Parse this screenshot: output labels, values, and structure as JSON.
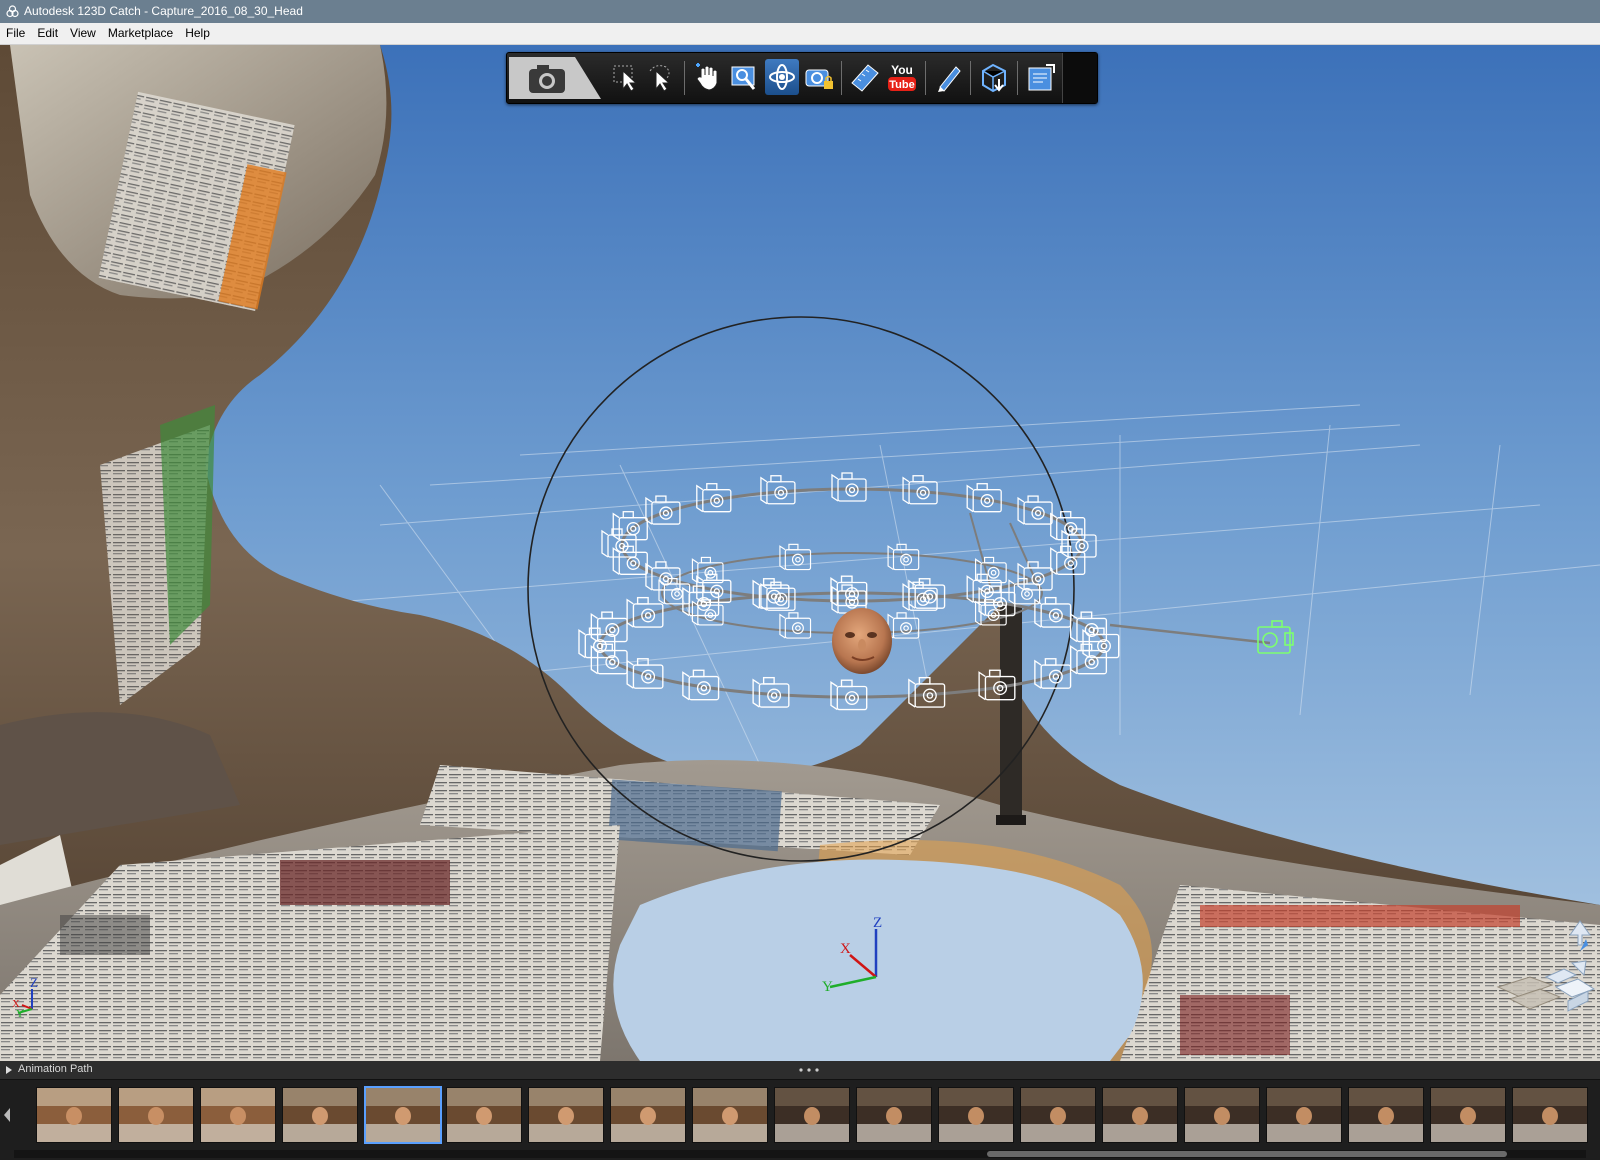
{
  "window": {
    "title": "Autodesk 123D Catch - Capture_2016_08_30_Head",
    "app_icon": "autodesk-trefoil-icon"
  },
  "menubar": {
    "items": [
      {
        "label": "File",
        "name": "menu-file"
      },
      {
        "label": "Edit",
        "name": "menu-edit"
      },
      {
        "label": "View",
        "name": "menu-view"
      },
      {
        "label": "Marketplace",
        "name": "menu-marketplace"
      },
      {
        "label": "Help",
        "name": "menu-help"
      }
    ]
  },
  "toolbar": {
    "buttons": [
      {
        "icon": "camera-tab-icon"
      },
      {
        "icon": "select-arrow-icon"
      },
      {
        "icon": "lasso-select-icon"
      },
      {
        "icon": "pan-hand-icon"
      },
      {
        "icon": "zoom-icon"
      },
      {
        "icon": "orbit-icon",
        "active": true
      },
      {
        "icon": "camera-lock-icon"
      },
      {
        "icon": "ruler-icon"
      },
      {
        "icon": "youtube-icon",
        "text_top": "You",
        "text_bottom": "Tube"
      },
      {
        "icon": "pen-icon"
      },
      {
        "icon": "mesh-download-icon"
      },
      {
        "icon": "export-icon"
      }
    ]
  },
  "viewport": {
    "gizmo": {
      "x_label": "X",
      "y_label": "Y",
      "z_label": "Z"
    },
    "corner_triad": {
      "x_label": "X",
      "y_label": "Y",
      "z_label": "Z"
    },
    "colors": {
      "x_axis": "#d01515",
      "y_axis": "#1fae2a",
      "z_axis": "#2040c0",
      "camera_wire": "#ffffff",
      "selected_camera": "#7dff70"
    }
  },
  "bottom_panel": {
    "title": "Animation Path",
    "expand_icon": "triangle-right-icon",
    "grip_icon": "ellipsis-grip-icon",
    "thumbnails": [
      {
        "id": 1,
        "selected": false
      },
      {
        "id": 2,
        "selected": false
      },
      {
        "id": 3,
        "selected": false
      },
      {
        "id": 4,
        "selected": false
      },
      {
        "id": 5,
        "selected": true
      },
      {
        "id": 6,
        "selected": false
      },
      {
        "id": 7,
        "selected": false
      },
      {
        "id": 8,
        "selected": false
      },
      {
        "id": 9,
        "selected": false
      },
      {
        "id": 10,
        "selected": false
      },
      {
        "id": 11,
        "selected": false
      },
      {
        "id": 12,
        "selected": false
      },
      {
        "id": 13,
        "selected": false
      },
      {
        "id": 14,
        "selected": false
      },
      {
        "id": 15,
        "selected": false
      },
      {
        "id": 16,
        "selected": false
      },
      {
        "id": 17,
        "selected": false
      },
      {
        "id": 18,
        "selected": false
      },
      {
        "id": 19,
        "selected": false
      }
    ]
  }
}
